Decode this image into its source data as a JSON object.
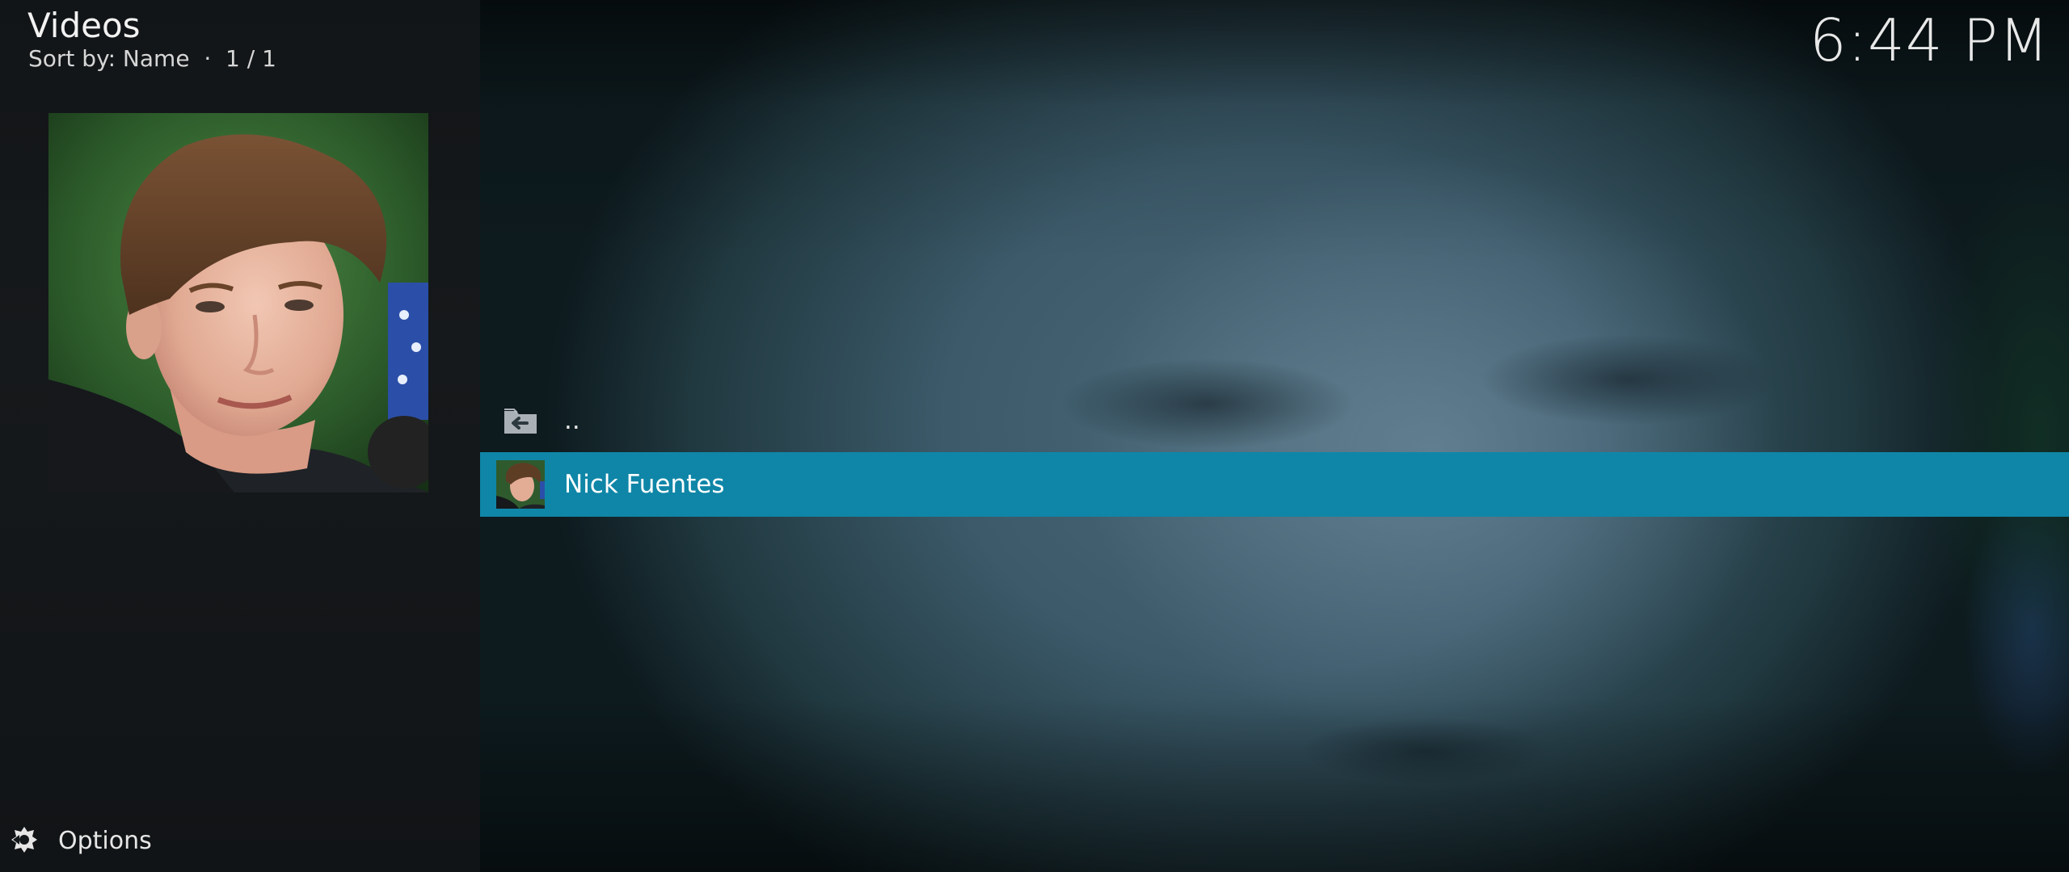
{
  "header": {
    "title": "Videos",
    "subtitle": "Sort by: Name  ·  1 / 1"
  },
  "clock": "6:44 PM",
  "list": {
    "items": [
      {
        "label": "..",
        "icon": "folder-back-icon"
      },
      {
        "label": "Nick Fuentes",
        "icon": "person-thumbnail",
        "focused": true
      }
    ]
  },
  "options": {
    "label": "Options",
    "icon": "options-icon"
  },
  "colors": {
    "focus": "#0f86a7",
    "panel": "#141719"
  }
}
